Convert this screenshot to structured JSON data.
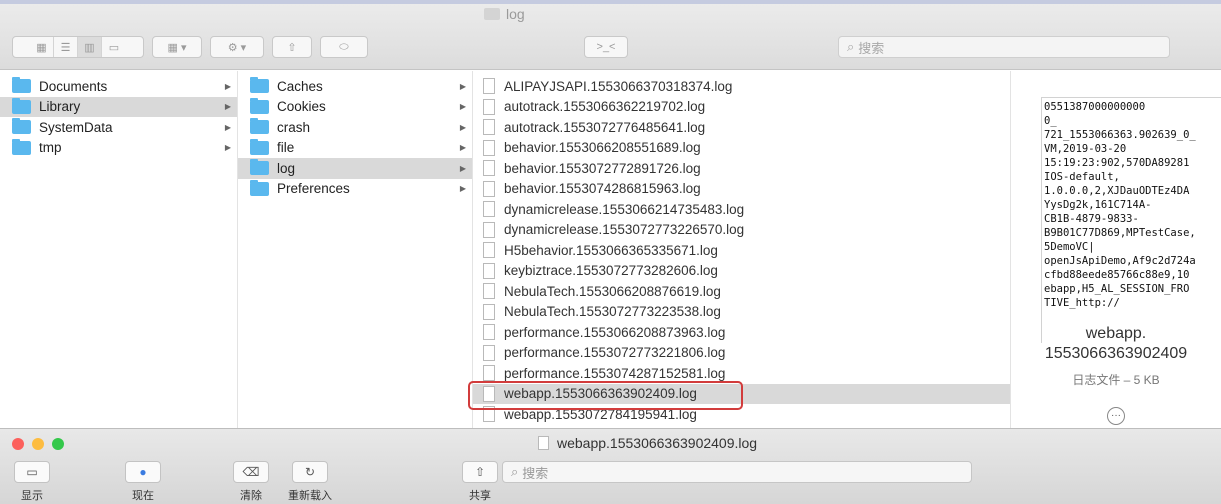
{
  "window": {
    "title": "log"
  },
  "toolbar": {
    "search_placeholder": "搜索",
    "view_icons": [
      "icon-view-icon",
      "list-view-icon",
      "column-view-icon",
      "gallery-view-icon"
    ]
  },
  "column1": [
    {
      "label": "Documents",
      "selected": false
    },
    {
      "label": "Library",
      "selected": true
    },
    {
      "label": "SystemData",
      "selected": false
    },
    {
      "label": "tmp",
      "selected": false
    }
  ],
  "column2": [
    {
      "label": "Caches",
      "selected": false
    },
    {
      "label": "Cookies",
      "selected": false
    },
    {
      "label": "crash",
      "selected": false
    },
    {
      "label": "file",
      "selected": false
    },
    {
      "label": "log",
      "selected": true
    },
    {
      "label": "Preferences",
      "selected": false
    }
  ],
  "column3": [
    "ALIPAYJSAPI.1553066370318374.log",
    "autotrack.1553066362219702.log",
    "autotrack.1553072776485641.log",
    "behavior.1553066208551689.log",
    "behavior.1553072772891726.log",
    "behavior.1553074286815963.log",
    "dynamicrelease.1553066214735483.log",
    "dynamicrelease.1553072773226570.log",
    "H5behavior.1553066365335671.log",
    "keybiztrace.1553072773282606.log",
    "NebulaTech.1553066208876619.log",
    "NebulaTech.1553072773223538.log",
    "performance.1553066208873963.log",
    "performance.1553072773221806.log",
    "performance.1553074287152581.log",
    "webapp.1553066363902409.log",
    "webapp.1553072784195941.log"
  ],
  "selected_file_index": 15,
  "preview": {
    "text": "0551387000000000\n0_\n721_1553066363.902639_0_\nVM,2019-03-20\n15:19:23:902,570DA89281\nIOS-default,\n1.0.0.0,2,XJDauODTEz4DA\nYysDg2k,161C714A-\nCB1B-4879-9833-\nB9B01C77D869,MPTestCase,\n5DemoVC|\nopenJsApiDemo,Af9c2d724a\ncfbd88eede85766c88e9,10\nebapp,H5_AL_SESSION_FRO\nTIVE_http://",
    "name_line1": "webapp.",
    "name_line2": "1553066363902409",
    "meta": "日志文件 – 5 KB"
  },
  "quicklook": {
    "title": "webapp.1553066363902409.log",
    "buttons": [
      {
        "label": "显示",
        "icon": "folder-icon"
      },
      {
        "label": "现在",
        "icon": "magnify-icon"
      },
      {
        "label": "清除",
        "icon": "clear-icon"
      },
      {
        "label": "重新载入",
        "icon": "reload-icon"
      },
      {
        "label": "共享",
        "icon": "share-icon"
      }
    ],
    "search_placeholder": "搜索"
  },
  "colors": {
    "folder": "#5ab8ee",
    "highlight": "#d23c3c",
    "selection": "#d9d9d9"
  }
}
